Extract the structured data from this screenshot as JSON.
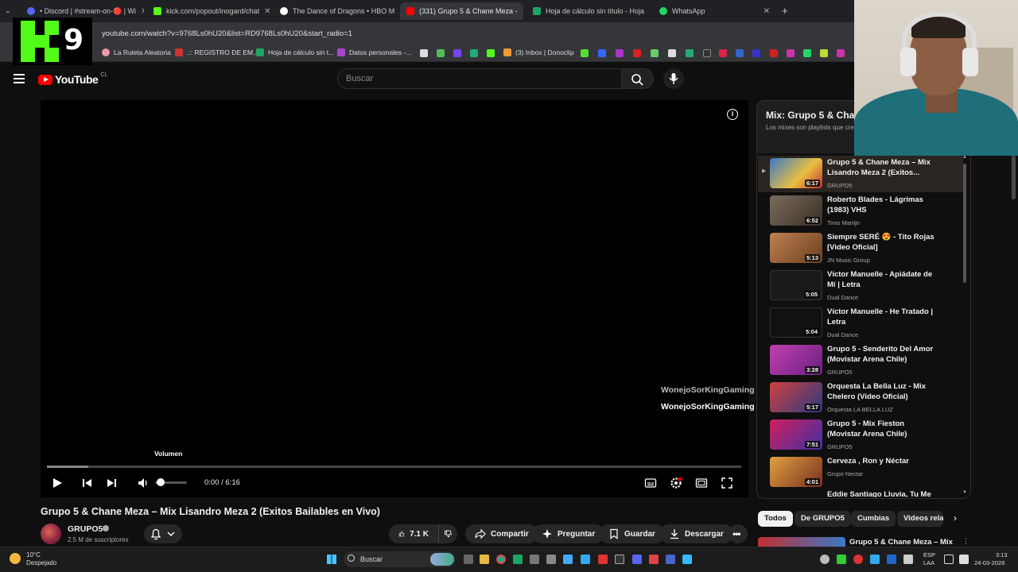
{
  "browser": {
    "tabs": [
      {
        "label": "• Discord | #stream-on-🔴 | Wi",
        "active": false
      },
      {
        "label": "kick.com/popout/inogard/chat",
        "active": false
      },
      {
        "label": "The Dance of Dragons • HBO M",
        "active": false
      },
      {
        "label": "(331) Grupo 5 & Chane Meza -",
        "active": true
      },
      {
        "label": "Hoja de cálculo sin título - Hoja",
        "active": false
      },
      {
        "label": "WhatsApp",
        "active": false
      }
    ],
    "new_tab": "+",
    "url": "youtube.com/watch?v=9768Ls0hU20&list=RD9768Ls0hU20&start_radio=1",
    "bookmarks": [
      "La Ruleta Aleatoria",
      ".:: REGISTRO DE EM...",
      "Hoja de cálculo sin t...",
      "Datos personales -...",
      "(3) Inbox | Donoclip"
    ]
  },
  "overlay": {
    "logo_digit": "9"
  },
  "youtube": {
    "logo_text": "YouTube",
    "region": "CL",
    "search_placeholder": "Buscar"
  },
  "player": {
    "tooltip": "Volumen",
    "time": "0:00 / 6:16",
    "progress": 0.0,
    "buffered": 0.06,
    "volume": 0.1,
    "chat_overlay": [
      "WonejoSorKingGaming :",
      "WonejoSorKingGaming :"
    ]
  },
  "video": {
    "title": "Grupo 5 & Chane Meza – Mix Lisandro Meza 2 (Exitos Bailables en Vivo)",
    "channel": "GRUPO5",
    "subscribers": "2.5 M de suscriptores",
    "likes": "7.1 K",
    "actions": [
      "Compartir",
      "Preguntar",
      "Guardar",
      "Descargar"
    ]
  },
  "playlist": {
    "title": "Mix: Grupo 5 & Cha",
    "subtitle": "Los mixes son playlists que cre",
    "items": [
      {
        "title": "Grupo 5 & Chane Meza – Mix Lisandro Meza 2 (Exitos...",
        "channel": "GRUPO5",
        "duration": "6:17",
        "active": true,
        "thumb": "#3a78c8"
      },
      {
        "title": "Roberto Blades - Lágrimas (1983) VHS",
        "channel": "Timo Martijn",
        "duration": "6:52",
        "active": false,
        "thumb": "#6a5a4a"
      },
      {
        "title": "Siempre SERÉ 😍 - Tito Rojas [Video Oficial]",
        "channel": "JN Music Group",
        "duration": "5:13",
        "active": false,
        "thumb": "#b07040"
      },
      {
        "title": "Víctor Manuelle - Apiádate de Mí | Letra",
        "channel": "Dual Dance",
        "duration": "5:05",
        "active": false,
        "thumb": "#222222"
      },
      {
        "title": "Víctor Manuelle - He Tratado | Letra",
        "channel": "Dual Dance",
        "duration": "5:04",
        "active": false,
        "thumb": "#1a1a1a"
      },
      {
        "title": "Grupo 5 - Senderito Del Amor (Movistar Arena Chile)",
        "channel": "GRUPO5",
        "duration": "3:28",
        "active": false,
        "thumb": "#a03090"
      },
      {
        "title": "Orquesta La Bella Luz - Mix Chelero (Video Oficial)",
        "channel": "Orquesta LA BELLA LUZ",
        "duration": "5:17",
        "active": false,
        "thumb": "#c03030"
      },
      {
        "title": "Grupo 5 - Mix Fieston (Movistar Arena Chile)",
        "channel": "GRUPO5",
        "duration": "7:51",
        "active": false,
        "thumb": "#b02050"
      },
      {
        "title": "Cerveza , Ron y Néctar",
        "channel": "Grupo Nectar",
        "duration": "4:01",
        "active": false,
        "thumb": "#c08030"
      },
      {
        "title": "Eddie Santiago Lluvia, Tu Me",
        "channel": "",
        "duration": "",
        "active": false,
        "thumb": "#333333"
      }
    ]
  },
  "chips": [
    "Todos",
    "De GRUPO5",
    "Cumbias",
    "Videos rela"
  ],
  "next_video": "Grupo 5 & Chane Meza – Mix",
  "taskbar": {
    "weather_temp": "10°C",
    "weather_desc": "Despejado",
    "search": "Buscar",
    "lang1": "ESP",
    "lang2": "LAA",
    "time": "3:13",
    "date": "24-03-2026"
  }
}
